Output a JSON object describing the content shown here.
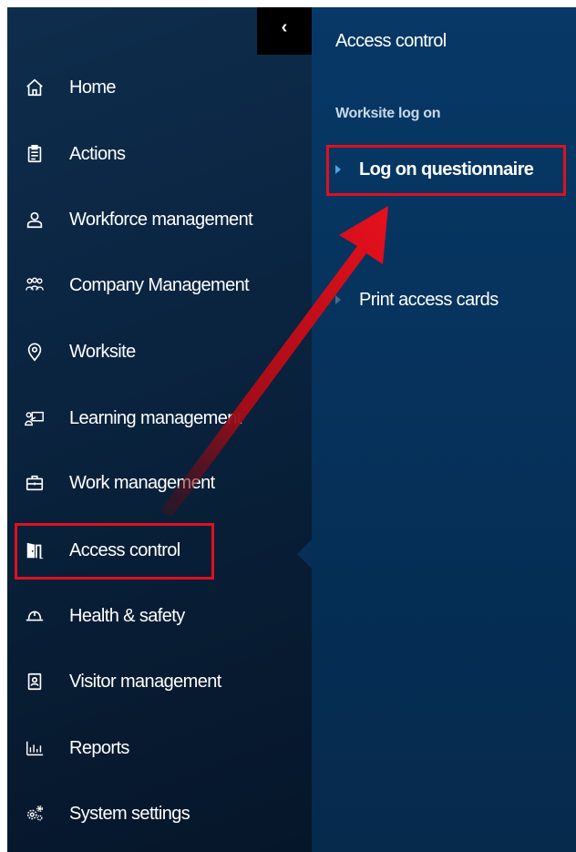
{
  "sidebar": {
    "collapse_glyph": "‹",
    "items": [
      {
        "label": "Home",
        "icon": "home-icon"
      },
      {
        "label": "Actions",
        "icon": "clipboard-icon"
      },
      {
        "label": "Workforce management",
        "icon": "person-icon"
      },
      {
        "label": "Company Management",
        "icon": "group-icon"
      },
      {
        "label": "Worksite",
        "icon": "location-pin-icon"
      },
      {
        "label": "Learning management",
        "icon": "presentation-icon"
      },
      {
        "label": "Work management",
        "icon": "briefcase-icon"
      },
      {
        "label": "Access control",
        "icon": "door-icon",
        "active": true
      },
      {
        "label": "Health & safety",
        "icon": "hard-hat-icon"
      },
      {
        "label": "Visitor management",
        "icon": "id-badge-icon"
      },
      {
        "label": "Reports",
        "icon": "bar-chart-icon"
      },
      {
        "label": "System settings",
        "icon": "gears-icon"
      }
    ]
  },
  "panel": {
    "title": "Access control",
    "section": "Worksite log on",
    "items": [
      {
        "label": "Log on questionnaire",
        "highlighted": true
      },
      {
        "label": "Print access cards"
      }
    ]
  },
  "colors": {
    "sidebar_bg": "#0a2440",
    "panel_bg": "#06335d",
    "highlight": "#e0101e",
    "accent_triangle": "#4fa3e6"
  }
}
